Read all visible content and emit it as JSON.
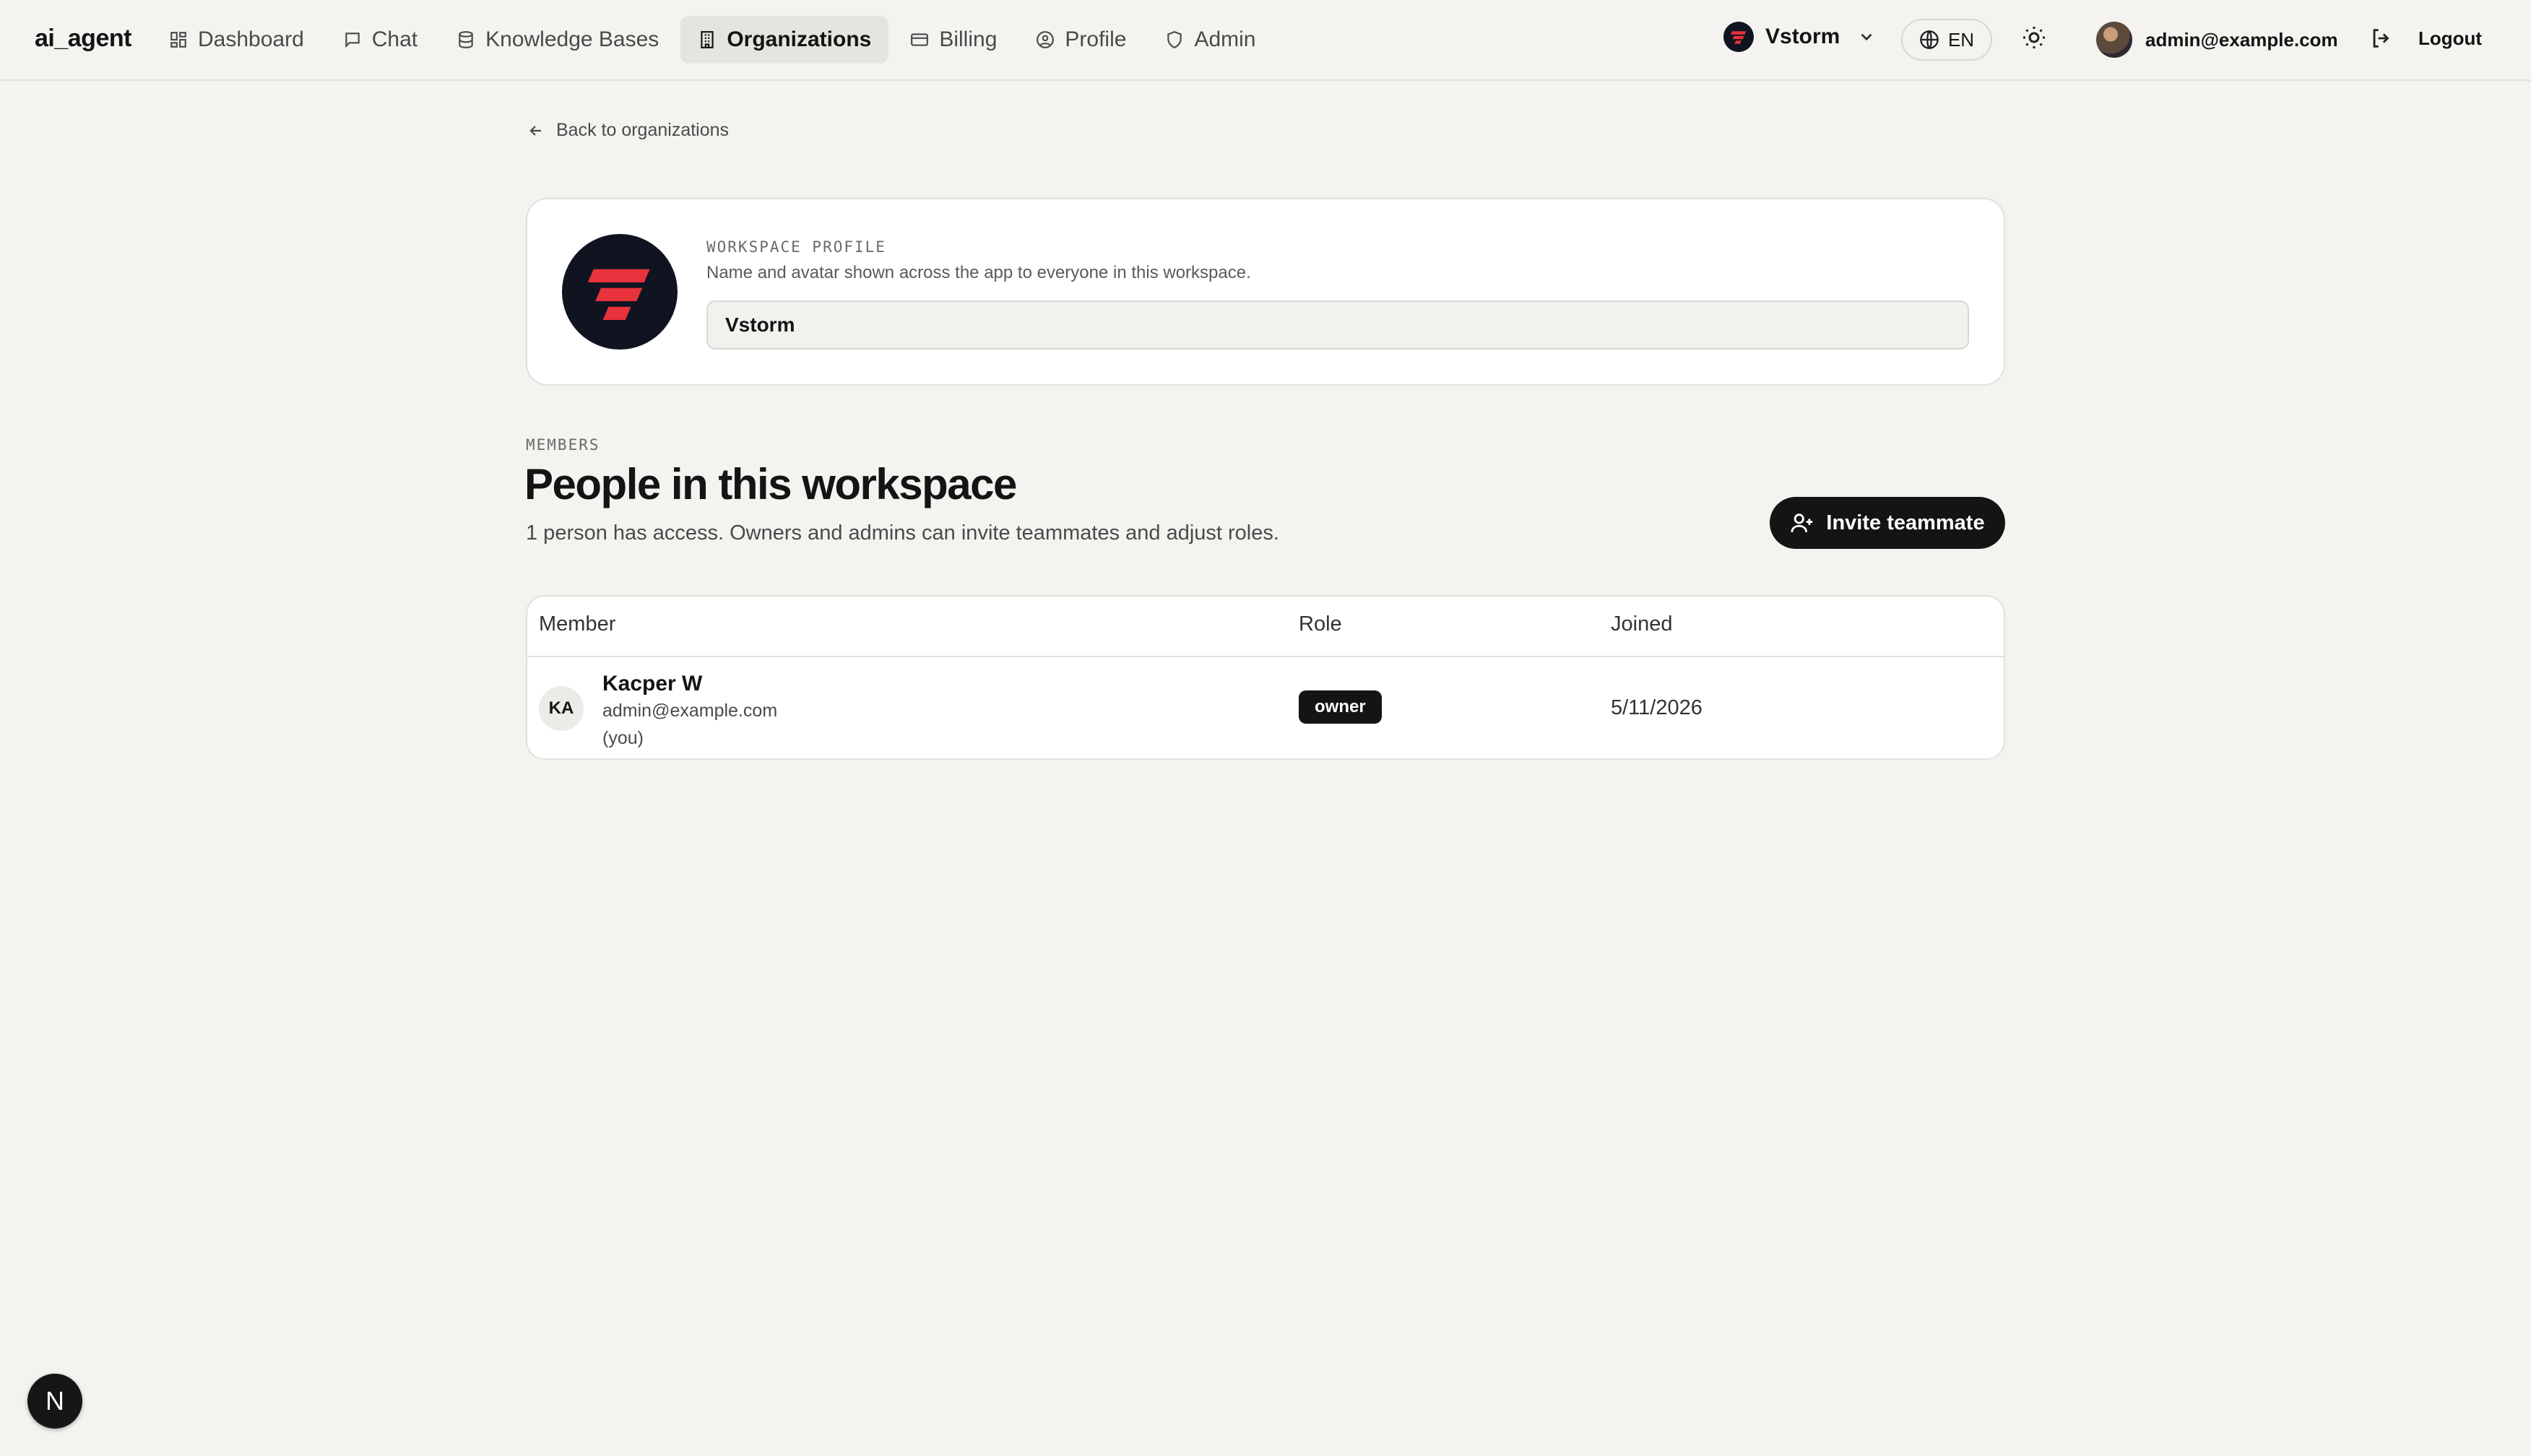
{
  "app": {
    "brand": "ai_agent"
  },
  "nav": {
    "items": [
      {
        "label": "Dashboard",
        "icon": "dashboard-icon"
      },
      {
        "label": "Chat",
        "icon": "chat-icon"
      },
      {
        "label": "Knowledge Bases",
        "icon": "database-icon"
      },
      {
        "label": "Organizations",
        "icon": "building-icon",
        "active": true
      },
      {
        "label": "Billing",
        "icon": "credit-card-icon"
      },
      {
        "label": "Profile",
        "icon": "user-circle-icon"
      },
      {
        "label": "Admin",
        "icon": "shield-icon"
      }
    ]
  },
  "header": {
    "org_name": "Vstorm",
    "language": "EN",
    "user_email": "admin@example.com",
    "logout_label": "Logout"
  },
  "back_link": "Back to organizations",
  "workspace_profile": {
    "overline": "WORKSPACE PROFILE",
    "description": "Name and avatar shown across the app to everyone in this workspace.",
    "name_value": "Vstorm"
  },
  "members": {
    "overline": "MEMBERS",
    "title": "People in this workspace",
    "subtitle": "1 person has access. Owners and admins can invite teammates and adjust roles.",
    "invite_label": "Invite teammate",
    "columns": [
      "Member",
      "Role",
      "Joined"
    ],
    "rows": [
      {
        "initials": "KA",
        "name": "Kacper W",
        "email": "admin@example.com",
        "note": "(you)",
        "role": "owner",
        "joined": "5/11/2026"
      }
    ]
  },
  "floating": {
    "label": "N"
  },
  "colors": {
    "accent": "#141414",
    "brand_red": "#e8323c",
    "background": "#f4f3f0"
  }
}
